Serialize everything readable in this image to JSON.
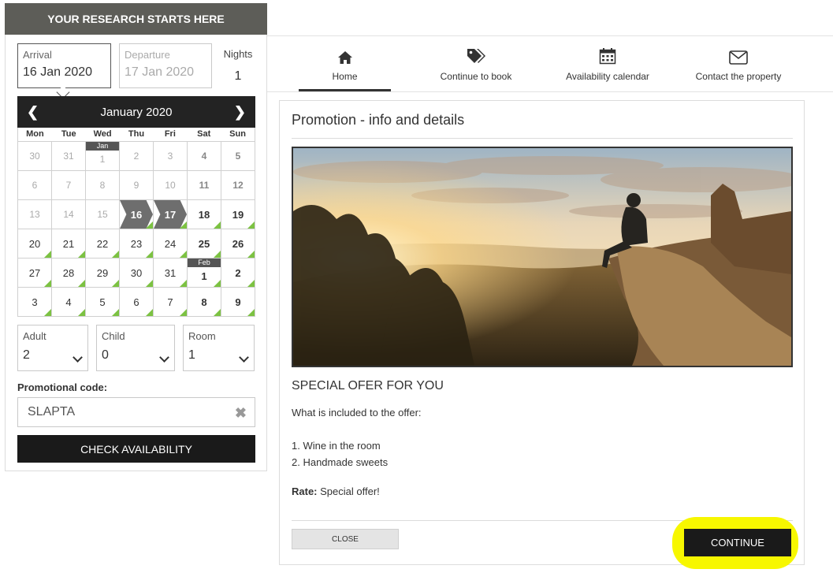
{
  "booking": {
    "header": "YOUR RESEARCH STARTS HERE",
    "arrival": {
      "label": "Arrival",
      "value": "16 Jan 2020"
    },
    "departure": {
      "label": "Departure",
      "value": "17 Jan 2020"
    },
    "nights": {
      "label": "Nights",
      "value": "1"
    },
    "calendar": {
      "month": "January 2020",
      "days_of_week": [
        "Mon",
        "Tue",
        "Wed",
        "Thu",
        "Fri",
        "Sat",
        "Sun"
      ],
      "cells": [
        {
          "n": "30",
          "s": "past"
        },
        {
          "n": "31",
          "s": "past"
        },
        {
          "n": "1",
          "s": "past",
          "m": "Jan"
        },
        {
          "n": "2",
          "s": "past"
        },
        {
          "n": "3",
          "s": "past"
        },
        {
          "n": "4",
          "s": "pastb"
        },
        {
          "n": "5",
          "s": "pastb"
        },
        {
          "n": "6",
          "s": "past"
        },
        {
          "n": "7",
          "s": "past"
        },
        {
          "n": "8",
          "s": "past"
        },
        {
          "n": "9",
          "s": "past"
        },
        {
          "n": "10",
          "s": "past"
        },
        {
          "n": "11",
          "s": "pastb"
        },
        {
          "n": "12",
          "s": "pastb"
        },
        {
          "n": "13",
          "s": "past"
        },
        {
          "n": "14",
          "s": "past"
        },
        {
          "n": "15",
          "s": "past"
        },
        {
          "n": "16",
          "s": "sel"
        },
        {
          "n": "17",
          "s": "sel"
        },
        {
          "n": "18",
          "s": "bold"
        },
        {
          "n": "19",
          "s": "bold"
        },
        {
          "n": "20",
          "s": "avail"
        },
        {
          "n": "21",
          "s": "avail"
        },
        {
          "n": "22",
          "s": "avail"
        },
        {
          "n": "23",
          "s": "avail"
        },
        {
          "n": "24",
          "s": "avail"
        },
        {
          "n": "25",
          "s": "bold"
        },
        {
          "n": "26",
          "s": "bold"
        },
        {
          "n": "27",
          "s": "avail"
        },
        {
          "n": "28",
          "s": "avail"
        },
        {
          "n": "29",
          "s": "avail"
        },
        {
          "n": "30",
          "s": "avail"
        },
        {
          "n": "31",
          "s": "avail"
        },
        {
          "n": "1",
          "s": "bold",
          "m": "Feb"
        },
        {
          "n": "2",
          "s": "bold"
        },
        {
          "n": "3",
          "s": "avail"
        },
        {
          "n": "4",
          "s": "avail"
        },
        {
          "n": "5",
          "s": "avail"
        },
        {
          "n": "6",
          "s": "avail"
        },
        {
          "n": "7",
          "s": "avail"
        },
        {
          "n": "8",
          "s": "bold"
        },
        {
          "n": "9",
          "s": "bold"
        }
      ]
    },
    "adult": {
      "label": "Adult",
      "value": "2"
    },
    "child": {
      "label": "Child",
      "value": "0"
    },
    "room": {
      "label": "Room",
      "value": "1"
    },
    "promo_label": "Promotional code:",
    "promo_value": "SLAPTA",
    "check_button": "CHECK AVAILABILITY"
  },
  "nav": {
    "home": "Home",
    "continue": "Continue to book",
    "availability": "Availability calendar",
    "contact": "Contact the property"
  },
  "modal": {
    "title": "Promotion - info and details",
    "offer_title": "SPECIAL OFER FOR YOU",
    "offer_sub": "What is included to the offer:",
    "items": [
      "1. Wine in the room",
      "2. Handmade sweets"
    ],
    "rate_label": "Rate:",
    "rate_value": " Special offer!",
    "close_button": "CLOSE",
    "continue_button": "CONTINUE"
  },
  "colors": {
    "available": "#7cc242",
    "dark": "#1a1a1a",
    "highlight": "#f7f700"
  }
}
